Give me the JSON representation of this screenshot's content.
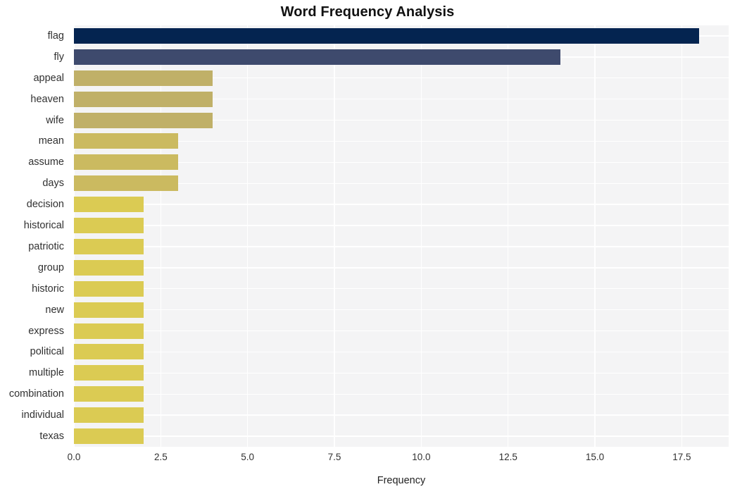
{
  "chart_data": {
    "type": "bar",
    "orientation": "horizontal",
    "title": "Word Frequency Analysis",
    "xlabel": "Frequency",
    "ylabel": "",
    "categories": [
      "flag",
      "fly",
      "appeal",
      "heaven",
      "wife",
      "mean",
      "assume",
      "days",
      "decision",
      "historical",
      "patriotic",
      "group",
      "historic",
      "new",
      "express",
      "political",
      "multiple",
      "combination",
      "individual",
      "texas"
    ],
    "values": [
      18,
      14,
      4,
      4,
      4,
      3,
      3,
      3,
      2,
      2,
      2,
      2,
      2,
      2,
      2,
      2,
      2,
      2,
      2,
      2
    ],
    "bar_colors": [
      "#042450",
      "#3e4a6d",
      "#c0b068",
      "#c0b068",
      "#c0b068",
      "#cbba60",
      "#cbba60",
      "#cbba60",
      "#dbcb53",
      "#dbcb53",
      "#dbcb53",
      "#dbcb53",
      "#dbcb53",
      "#dbcb53",
      "#dbcb53",
      "#dbcb53",
      "#dbcb53",
      "#dbcb53",
      "#dbcb53",
      "#dbcb53"
    ],
    "xlim": [
      0,
      18.85
    ],
    "xticks": [
      0,
      2.5,
      5,
      7.5,
      10,
      12.5,
      15,
      17.5
    ],
    "xtick_labels": [
      "0.0",
      "2.5",
      "5.0",
      "7.5",
      "10.0",
      "12.5",
      "15.0",
      "17.5"
    ],
    "grid": true,
    "grid_color": "#ffffff",
    "plot_background": "#f4f4f5",
    "figure_background": "#ffffff",
    "legend": null
  }
}
